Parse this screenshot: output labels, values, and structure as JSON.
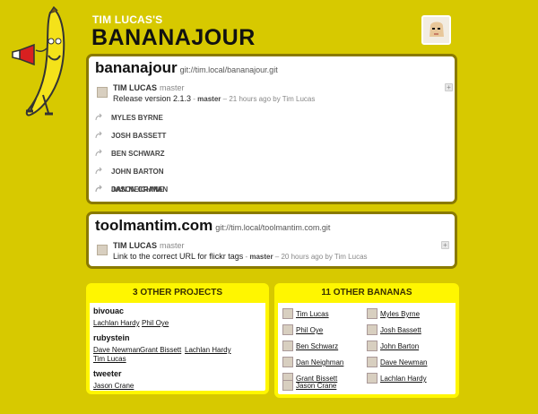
{
  "header": {
    "subtitle": "TIM LUCAS'S",
    "title": "BANANAJOUR"
  },
  "repos": [
    {
      "name": "bananajour",
      "url": "git://tim.local/bananajour.git",
      "commit": {
        "author": "TIM LUCAS",
        "branch": "master",
        "message": "Release version 2.1.3",
        "meta_sep": " - ",
        "meta_branch": "master",
        "meta_rest": " – 21 hours ago by Tim Lucas"
      },
      "members": [
        "MYLES BYRNE",
        "JOSH BASSETT",
        "BEN SCHWARZ",
        "JOHN BARTON",
        "DAN NEIGHMAN",
        "JASON CRANE"
      ]
    },
    {
      "name": "toolmantim.com",
      "url": "git://tim.local/toolmantim.com.git",
      "commit": {
        "author": "TIM LUCAS",
        "branch": "master",
        "message": "Link to the correct URL for flickr tags",
        "meta_sep": " - ",
        "meta_branch": "master",
        "meta_rest": " – 20 hours ago by Tim Lucas"
      }
    }
  ],
  "other_projects": {
    "heading": "3 OTHER PROJECTS",
    "projects": [
      {
        "title": "bivouac",
        "people": [
          "Lachlan Hardy",
          "Phil Oye"
        ]
      },
      {
        "title": "rubystein",
        "people": [
          "Dave Newman",
          "Grant Bissett",
          "Lachlan Hardy",
          "Tim Lucas"
        ]
      },
      {
        "title": "tweeter",
        "people": [
          "Jason Crane"
        ]
      }
    ]
  },
  "other_bananas": {
    "heading": "11 OTHER BANANAS",
    "left": [
      "Tim Lucas",
      "Phil Oye",
      "Ben Schwarz",
      "Dan Neighman",
      "Grant Bissett",
      "Jason Crane"
    ],
    "right": [
      "Myles Byrne",
      "Josh Bassett",
      "John Barton",
      "Dave Newman",
      "Lachlan Hardy"
    ]
  },
  "colors": {
    "background": "#d7c900",
    "panel_accent": "#fff600",
    "border": "#8a7a00"
  }
}
